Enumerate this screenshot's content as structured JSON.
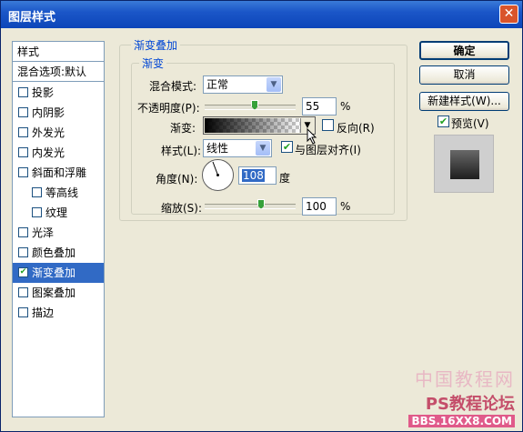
{
  "window": {
    "title": "图层样式"
  },
  "style_list": {
    "header": "样式",
    "blend_options": "混合选项:默认",
    "items": [
      {
        "label": "投影",
        "checked": false
      },
      {
        "label": "内阴影",
        "checked": false
      },
      {
        "label": "外发光",
        "checked": false
      },
      {
        "label": "内发光",
        "checked": false
      },
      {
        "label": "斜面和浮雕",
        "checked": false
      },
      {
        "label": "等高线",
        "checked": false
      },
      {
        "label": "纹理",
        "checked": false
      },
      {
        "label": "光泽",
        "checked": false
      },
      {
        "label": "颜色叠加",
        "checked": false
      },
      {
        "label": "渐变叠加",
        "checked": true,
        "selected": true
      },
      {
        "label": "图案叠加",
        "checked": false
      },
      {
        "label": "描边",
        "checked": false
      }
    ]
  },
  "panel": {
    "outer_title": "渐变叠加",
    "inner_title": "渐变",
    "blend_mode_label": "混合模式:",
    "blend_mode_value": "正常",
    "opacity_label": "不透明度(P):",
    "opacity_value": "55",
    "opacity_unit": "%",
    "gradient_label": "渐变:",
    "reverse_label": "反向(R)",
    "reverse_checked": false,
    "style_label": "样式(L):",
    "style_value": "线性",
    "align_label": "与图层对齐(I)",
    "align_checked": true,
    "angle_label": "角度(N):",
    "angle_value": "108",
    "angle_unit": "度",
    "scale_label": "缩放(S):",
    "scale_value": "100",
    "scale_unit": "%"
  },
  "buttons": {
    "ok": "确定",
    "cancel": "取消",
    "new_style": "新建样式(W)...",
    "preview_label": "预览(V)",
    "preview_checked": true
  },
  "watermark": {
    "line1": "中国教程网",
    "line2": "PS教程论坛",
    "line3": "BBS.16XX8.COM"
  },
  "colors": {
    "accent": "#316ac5",
    "title_bar": "#0d46b9",
    "group_title": "#0046d5"
  }
}
